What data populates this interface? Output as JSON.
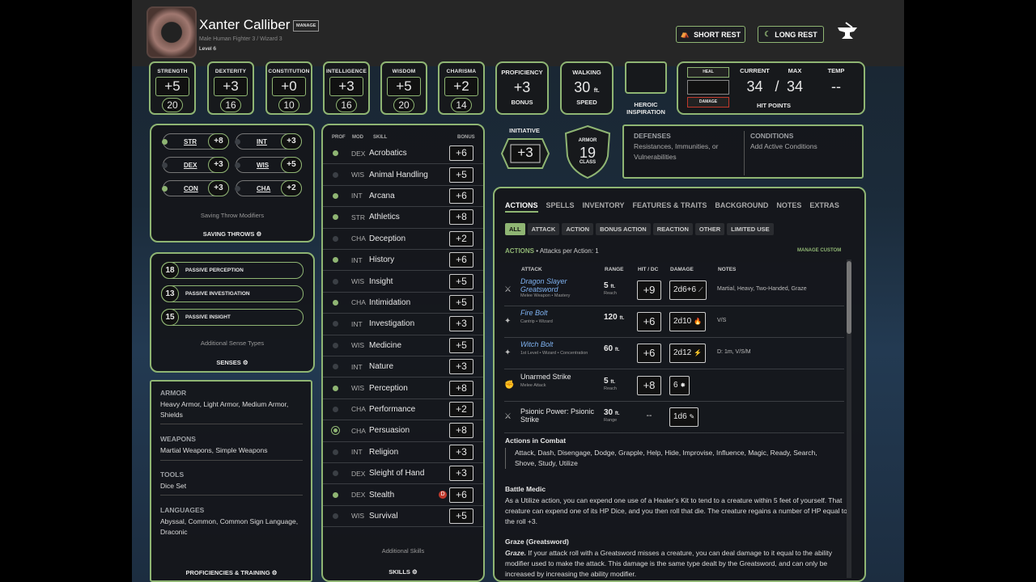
{
  "character": {
    "name": "Xanter Calliber",
    "manage": "MANAGE",
    "details": "Male  Human  Fighter 3 / Wizard 3",
    "level": "Level 6"
  },
  "rest": {
    "short": "SHORT REST",
    "long": "LONG REST"
  },
  "abilities": [
    {
      "label": "STRENGTH",
      "mod": "+5",
      "score": "20"
    },
    {
      "label": "DEXTERITY",
      "mod": "+3",
      "score": "16"
    },
    {
      "label": "CONSTITUTION",
      "mod": "+0",
      "score": "10"
    },
    {
      "label": "INTELLIGENCE",
      "mod": "+3",
      "score": "16"
    },
    {
      "label": "WISDOM",
      "mod": "+5",
      "score": "20"
    },
    {
      "label": "CHARISMA",
      "mod": "+2",
      "score": "14"
    }
  ],
  "proficiency": {
    "label": "PROFICIENCY",
    "value": "+3",
    "sub": "BONUS"
  },
  "speed": {
    "label": "WALKING",
    "value": "30",
    "unit": "ft.",
    "sub": "SPEED"
  },
  "inspiration": {
    "label": "HEROIC INSPIRATION"
  },
  "hp": {
    "heal": "HEAL",
    "damage": "DAMAGE",
    "current_label": "CURRENT",
    "max_label": "MAX",
    "temp_label": "TEMP",
    "current": "34",
    "slash": "/",
    "max": "34",
    "temp": "--",
    "title": "HIT POINTS"
  },
  "initiative": {
    "label": "INITIATIVE",
    "value": "+3"
  },
  "armor": {
    "top": "ARMOR",
    "value": "19",
    "bottom": "CLASS"
  },
  "defenses": {
    "title": "DEFENSES",
    "text": "Resistances, Immunities, or Vulnerabilities"
  },
  "conditions": {
    "title": "CONDITIONS",
    "text": "Add Active Conditions"
  },
  "saves": {
    "items": [
      {
        "name": "STR",
        "value": "+8",
        "prof": true
      },
      {
        "name": "INT",
        "value": "+3",
        "prof": false
      },
      {
        "name": "DEX",
        "value": "+3",
        "prof": false
      },
      {
        "name": "WIS",
        "value": "+5",
        "prof": false
      },
      {
        "name": "CON",
        "value": "+3",
        "prof": true
      },
      {
        "name": "CHA",
        "value": "+2",
        "prof": false
      }
    ],
    "note": "Saving Throw Modifiers",
    "title": "SAVING THROWS"
  },
  "senses": {
    "items": [
      {
        "value": "18",
        "label": "PASSIVE PERCEPTION"
      },
      {
        "value": "13",
        "label": "PASSIVE INVESTIGATION"
      },
      {
        "value": "15",
        "label": "PASSIVE INSIGHT"
      }
    ],
    "note": "Additional Sense Types",
    "title": "SENSES"
  },
  "proficiencies": {
    "armor_h": "ARMOR",
    "armor": "Heavy Armor, Light Armor, Medium Armor, Shields",
    "weapons_h": "WEAPONS",
    "weapons": "Martial Weapons, Simple Weapons",
    "tools_h": "TOOLS",
    "tools": "Dice Set",
    "languages_h": "LANGUAGES",
    "languages": "Abyssal, Common, Common Sign Language, Draconic",
    "title": "PROFICIENCIES & TRAINING"
  },
  "skills": {
    "headers": {
      "prof": "PROF",
      "mod": "MOD",
      "skill": "SKILL",
      "bonus": "BONUS"
    },
    "items": [
      {
        "mod": "DEX",
        "name": "Acrobatics",
        "bonus": "+6",
        "prof": true
      },
      {
        "mod": "WIS",
        "name": "Animal Handling",
        "bonus": "+5",
        "prof": false
      },
      {
        "mod": "INT",
        "name": "Arcana",
        "bonus": "+6",
        "prof": true
      },
      {
        "mod": "STR",
        "name": "Athletics",
        "bonus": "+8",
        "prof": true
      },
      {
        "mod": "CHA",
        "name": "Deception",
        "bonus": "+2",
        "prof": false
      },
      {
        "mod": "INT",
        "name": "History",
        "bonus": "+6",
        "prof": true
      },
      {
        "mod": "WIS",
        "name": "Insight",
        "bonus": "+5",
        "prof": false
      },
      {
        "mod": "CHA",
        "name": "Intimidation",
        "bonus": "+5",
        "prof": true
      },
      {
        "mod": "INT",
        "name": "Investigation",
        "bonus": "+3",
        "prof": false
      },
      {
        "mod": "WIS",
        "name": "Medicine",
        "bonus": "+5",
        "prof": false
      },
      {
        "mod": "INT",
        "name": "Nature",
        "bonus": "+3",
        "prof": false
      },
      {
        "mod": "WIS",
        "name": "Perception",
        "bonus": "+8",
        "prof": true
      },
      {
        "mod": "CHA",
        "name": "Performance",
        "bonus": "+2",
        "prof": false
      },
      {
        "mod": "CHA",
        "name": "Persuasion",
        "bonus": "+8",
        "prof": true,
        "expert": true
      },
      {
        "mod": "INT",
        "name": "Religion",
        "bonus": "+3",
        "prof": false
      },
      {
        "mod": "DEX",
        "name": "Sleight of Hand",
        "bonus": "+3",
        "prof": false
      },
      {
        "mod": "DEX",
        "name": "Stealth",
        "bonus": "+6",
        "prof": true,
        "disadvantage": true
      },
      {
        "mod": "WIS",
        "name": "Survival",
        "bonus": "+5",
        "prof": false
      }
    ],
    "note": "Additional Skills",
    "title": "SKILLS"
  },
  "tabs": [
    "ACTIONS",
    "SPELLS",
    "INVENTORY",
    "FEATURES & TRAITS",
    "BACKGROUND",
    "NOTES",
    "EXTRAS"
  ],
  "filters": [
    "ALL",
    "ATTACK",
    "ACTION",
    "BONUS ACTION",
    "REACTION",
    "OTHER",
    "LIMITED USE"
  ],
  "actions": {
    "title": "ACTIONS",
    "per": "• Attacks per Action: 1",
    "manage": "MANAGE CUSTOM",
    "cols": {
      "attack": "ATTACK",
      "range": "RANGE",
      "hit": "HIT / DC",
      "damage": "DAMAGE",
      "notes": "NOTES"
    },
    "rows": [
      {
        "name": "Dragon Slayer Greatsword",
        "sub": "Melee Weapon • Mastery",
        "range": "5",
        "range_unit": "ft.",
        "range_sub": "Reach",
        "hit": "+9",
        "damage": "2d6+6",
        "notes": "Martial, Heavy, Two-Handed, Graze",
        "magic": true
      },
      {
        "name": "Fire Bolt",
        "sub": "Cantrip • Wizard",
        "range": "120",
        "range_unit": "ft.",
        "range_sub": "",
        "hit": "+6",
        "damage": "2d10",
        "notes": "V/S",
        "magic": true
      },
      {
        "name": "Witch Bolt",
        "sub": "1st Level • Wizard • Concentration",
        "range": "60",
        "range_unit": "ft.",
        "range_sub": "",
        "hit": "+6",
        "damage": "2d12",
        "notes": "D: 1m, V/S/M",
        "magic": true
      },
      {
        "name": "Unarmed Strike",
        "sub": "Melee Attack",
        "range": "5",
        "range_unit": "ft.",
        "range_sub": "Reach",
        "hit": "+8",
        "damage": "6",
        "notes": "",
        "magic": false
      },
      {
        "name": "Psionic Power: Psionic Strike",
        "sub": "",
        "range": "30",
        "range_unit": "ft.",
        "range_sub": "Range",
        "hit": "--",
        "damage": "1d6",
        "notes": "",
        "magic": false
      }
    ]
  },
  "combat": {
    "title": "Actions in Combat",
    "text": "Attack, Dash, Disengage, Dodge, Grapple, Help, Hide, Improvise, Influence, Magic, Ready, Search, Shove, Study, Utilize"
  },
  "medic": {
    "title": "Battle Medic",
    "text": "As a Utilize action, you can expend one use of a Healer's Kit to tend to a creature within 5 feet of yourself. That creature can expend one of its HP Dice, and you then roll that die. The creature regains a number of HP equal to the roll +3."
  },
  "graze": {
    "title": "Graze (Greatsword)",
    "lead": "Graze.",
    "text": " If your attack roll with a Greatsword misses a creature, you can deal damage to it equal to the ability modifier used to make the attack. This damage is the same type dealt by the Greatsword, and can only be increased by increasing the ability modifier."
  },
  "colors": {
    "accent": "#8fb573",
    "magic": "#7fb2f0",
    "danger": "#c0392b"
  }
}
